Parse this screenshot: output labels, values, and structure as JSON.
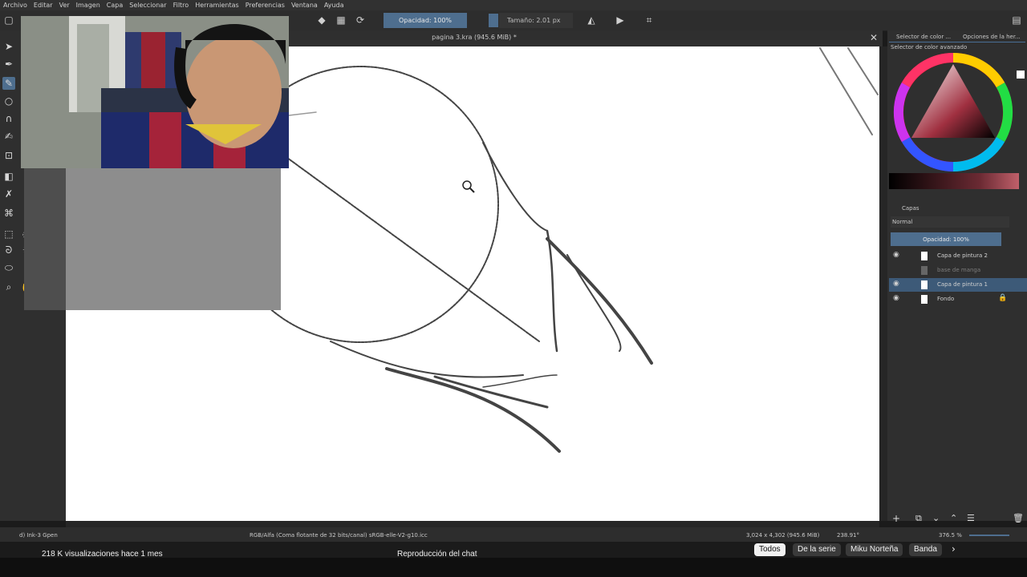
{
  "menu": [
    "Archivo",
    "Editar",
    "Ver",
    "Imagen",
    "Capa",
    "Seleccionar",
    "Filtro",
    "Herramientas",
    "Preferencias",
    "Ventana",
    "Ayuda"
  ],
  "toolbar": {
    "opacity": "Opacidad: 100%",
    "size": "Tamaño: 2.01 px"
  },
  "document": {
    "title": "pagina 3.kra (945.6 MiB) *"
  },
  "docker": {
    "tab_color": "Selector de color ...",
    "tab_tool_options": "Opciones de la her...",
    "color_selector_title": "Selector de color avanzado",
    "layers_title": "Capas",
    "blend_mode": "Normal",
    "layer_opacity": "Opacidad: 100%",
    "layers": [
      {
        "name": "Capa de pintura 2"
      },
      {
        "name": "base de manga"
      },
      {
        "name": "Capa de pintura 1"
      },
      {
        "name": "Fondo"
      }
    ]
  },
  "status": {
    "brush": "d) Ink-3 Gpen",
    "color_space": "RGB/Alfa (Coma flotante de 32 bits/canal)  sRGB-elle-V2-g10.icc",
    "dimensions": "3,024 x 4,302 (945.6 MiB)",
    "rotation": "238.91°",
    "zoom": "376.5 %"
  },
  "youtube": {
    "views": "218 K visualizaciones  hace 1 mes",
    "chat_replay": "Reproducción del chat",
    "chips": [
      "Todos",
      "De la serie",
      "Miku Norteña",
      "Banda"
    ]
  }
}
